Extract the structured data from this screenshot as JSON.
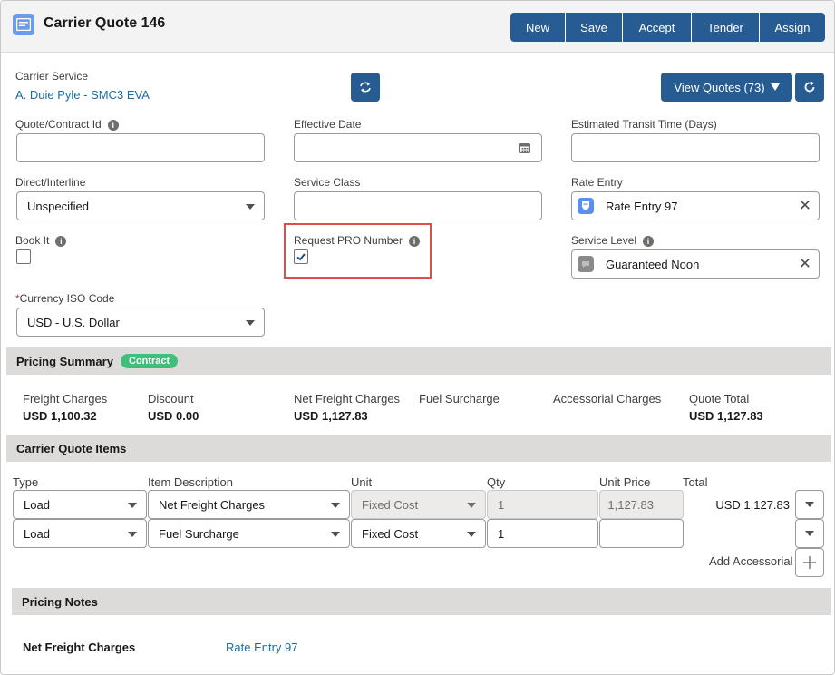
{
  "header": {
    "title": "Carrier Quote 146",
    "buttons": {
      "new": "New",
      "save": "Save",
      "accept": "Accept",
      "tender": "Tender",
      "assign": "Assign"
    }
  },
  "carrier_service": {
    "label": "Carrier Service",
    "value": "A. Duie Pyle - SMC3 EVA"
  },
  "view_quotes": {
    "label": "View Quotes (73)"
  },
  "fields": {
    "quote_contract_id": {
      "label": "Quote/Contract Id",
      "value": ""
    },
    "effective_date": {
      "label": "Effective Date",
      "value": ""
    },
    "estimated_transit": {
      "label": "Estimated Transit Time (Days)",
      "value": ""
    },
    "direct_interline": {
      "label": "Direct/Interline",
      "value": "Unspecified"
    },
    "service_class": {
      "label": "Service Class",
      "value": ""
    },
    "rate_entry": {
      "label": "Rate Entry",
      "value": "Rate Entry 97"
    },
    "book_it": {
      "label": "Book It",
      "checked": false
    },
    "request_pro": {
      "label": "Request PRO Number",
      "checked": true
    },
    "service_level": {
      "label": "Service Level",
      "value": "Guaranteed Noon"
    },
    "currency": {
      "required_mark": "*",
      "label": "Currency ISO Code",
      "value": "USD - U.S. Dollar"
    }
  },
  "pricing_summary": {
    "title": "Pricing Summary",
    "badge": "Contract",
    "items": [
      {
        "label": "Freight Charges",
        "value": "USD 1,100.32"
      },
      {
        "label": "Discount",
        "value": "USD 0.00"
      },
      {
        "label": "Net Freight Charges",
        "value": "USD 1,127.83"
      },
      {
        "label": "Fuel Surcharge",
        "value": ""
      },
      {
        "label": "Accessorial Charges",
        "value": ""
      },
      {
        "label": "Quote Total",
        "value": "USD 1,127.83"
      }
    ]
  },
  "quote_items": {
    "title": "Carrier Quote Items",
    "columns": [
      "Type",
      "Item Description",
      "Unit",
      "Qty",
      "Unit Price",
      "Total"
    ],
    "rows": [
      {
        "type": "Load",
        "description": "Net Freight Charges",
        "unit": "Fixed Cost",
        "qty": "1",
        "unit_price": "1,127.83",
        "total": "USD 1,127.83"
      },
      {
        "type": "Load",
        "description": "Fuel Surcharge",
        "unit": "Fixed Cost",
        "qty": "1",
        "unit_price": "",
        "total": ""
      }
    ],
    "add_accessorial": "Add Accessorial"
  },
  "pricing_notes": {
    "title": "Pricing Notes",
    "label": "Net Freight Charges",
    "value": "Rate Entry 97"
  },
  "colors": {
    "brand_blue": "#275c92",
    "link": "#1d6aa5",
    "badge_green": "#3fbf7a",
    "highlight_red": "#e04b4b"
  }
}
